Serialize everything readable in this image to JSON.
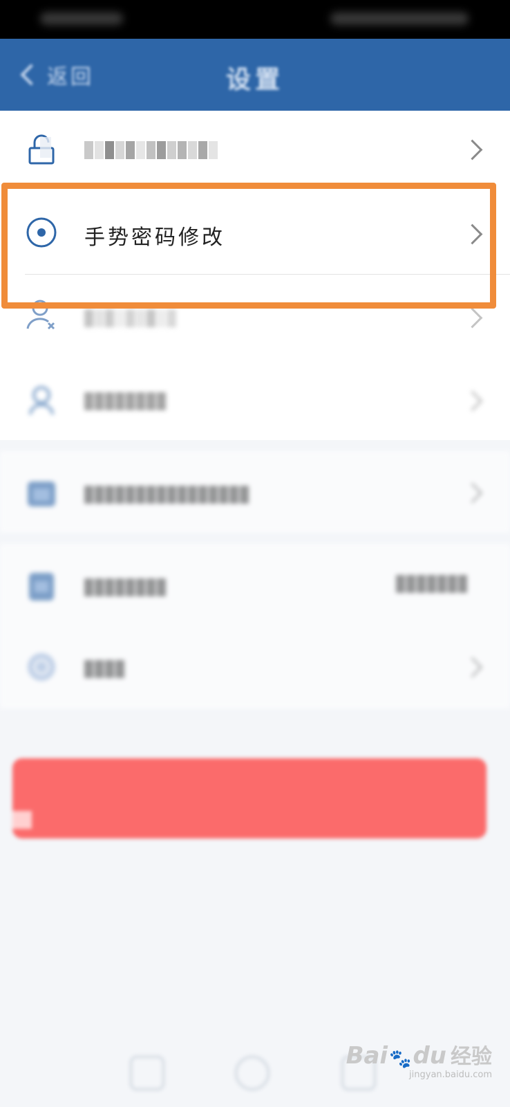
{
  "header": {
    "back_label": "返回",
    "title": "设置"
  },
  "settings": {
    "gesture_password_label": "手势密码修改"
  },
  "icons": {
    "lock": "lock-icon",
    "gesture": "radio-target-icon",
    "user_remove": "user-remove-icon",
    "user": "user-icon",
    "calendar": "calendar-icon",
    "clipboard": "clipboard-icon",
    "globe": "globe-icon",
    "back": "chevron-left-icon",
    "arrow": "chevron-right-icon"
  },
  "colors": {
    "nav_bar": "#2e66a8",
    "icon_blue": "#2e66a8",
    "highlight": "#f08c3a",
    "logout_button": "#fb6b6b",
    "background": "#f4f6f9"
  },
  "watermark": {
    "logo": "Bai",
    "logo_tail": "du",
    "suffix": "经验",
    "url": "jingyan.baidu.com"
  }
}
